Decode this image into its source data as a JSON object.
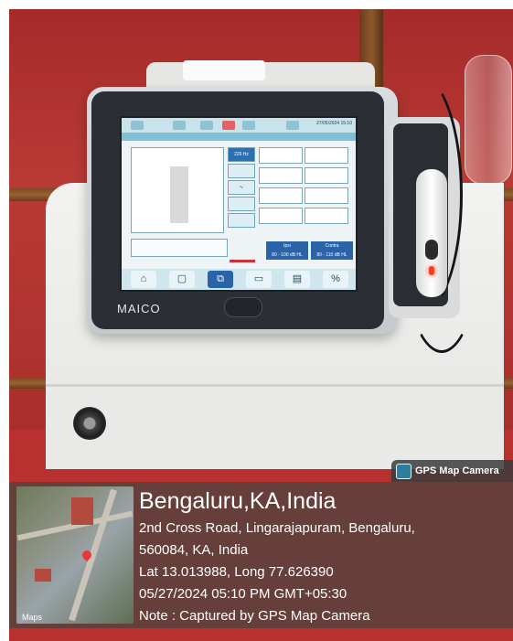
{
  "device": {
    "brand": "MAICO",
    "screen_date": "27/05/2024 15:10",
    "frequency_label": "226 Hz",
    "ranges": [
      {
        "label": "Ipsi",
        "value": "80 - 100 dB HL"
      },
      {
        "label": "Contra",
        "value": "80 - 110 dB HL"
      }
    ]
  },
  "gps_tag": {
    "label": "GPS Map Camera"
  },
  "map_thumb": {
    "label": "Maps"
  },
  "caption": {
    "city": "Bengaluru,KA,India",
    "address_line1": "2nd Cross Road, Lingarajapuram, Bengaluru,",
    "address_line2": "560084, KA, India",
    "coords": "Lat 13.013988, Long 77.626390",
    "datetime": "05/27/2024 05:10 PM GMT+05:30",
    "note": "Note : Captured by GPS Map Camera"
  },
  "colors": {
    "wall": "#b93a34",
    "screen_accent": "#2a63a8",
    "led": "#ff3a1f"
  }
}
